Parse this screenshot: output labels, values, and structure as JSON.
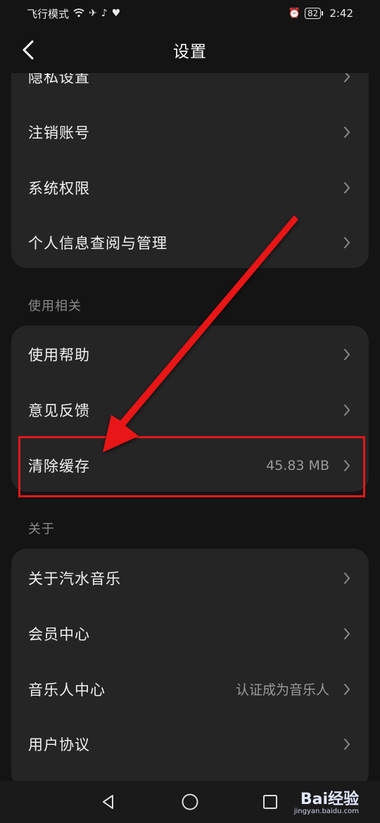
{
  "status_bar": {
    "mode": "飞行模式",
    "battery": "82",
    "time": "2:42"
  },
  "header": {
    "title": "设置"
  },
  "privacy_group": {
    "items": [
      {
        "label": "隐私设置"
      },
      {
        "label": "注销账号"
      },
      {
        "label": "系统权限"
      },
      {
        "label": "个人信息查阅与管理"
      }
    ]
  },
  "usage_section": {
    "title": "使用相关",
    "items": [
      {
        "label": "使用帮助"
      },
      {
        "label": "意见反馈"
      },
      {
        "label": "清除缓存",
        "value": "45.83 MB"
      }
    ]
  },
  "about_section": {
    "title": "关于",
    "items": [
      {
        "label": "关于汽水音乐"
      },
      {
        "label": "会员中心"
      },
      {
        "label": "音乐人中心",
        "value": "认证成为音乐人"
      },
      {
        "label": "用户协议"
      }
    ]
  },
  "watermark": {
    "logo": "Bai经验",
    "url": "jingyan.baidu.com"
  },
  "colors": {
    "background": "#141414",
    "card": "#252525",
    "annotation": "#e11919"
  }
}
